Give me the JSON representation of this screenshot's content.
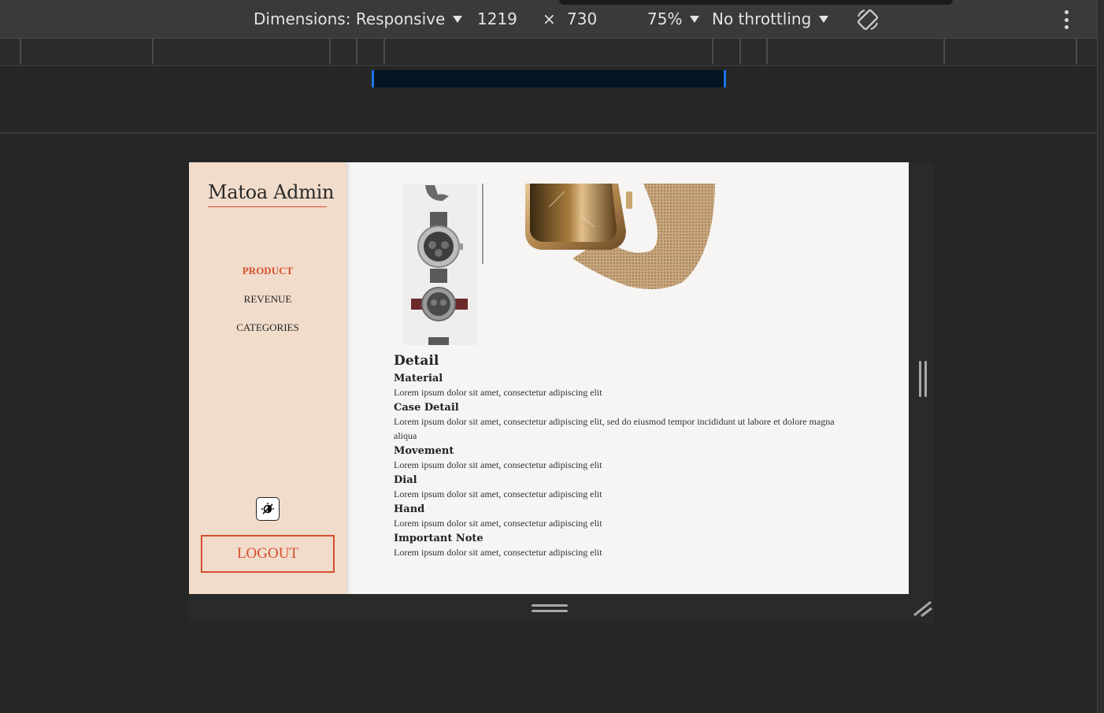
{
  "devtools": {
    "dimensions_label": "Dimensions: Responsive",
    "width": "1219",
    "times": "×",
    "height": "730",
    "zoom": "75%",
    "throttling": "No throttling",
    "icons": [
      "rotate-icon",
      "more-options-icon"
    ]
  },
  "app": {
    "brand": "Matoa Admin",
    "nav": [
      {
        "label": "PRODUCT",
        "active": true
      },
      {
        "label": "REVENUE",
        "active": false
      },
      {
        "label": "CATEGORIES",
        "active": false
      }
    ],
    "logout_label": "LOGOUT",
    "accent_color": "#d64e2f",
    "sidebar_color": "#f1dccb"
  },
  "detail": {
    "title": "Detail",
    "sections": [
      {
        "heading": "Material",
        "text": "Lorem ipsum dolor sit amet, consectetur adipiscing elit"
      },
      {
        "heading": "Case Detail",
        "text": "Lorem ipsum dolor sit amet, consectetur adipiscing elit, sed do eiusmod tempor incididunt ut labore et dolore magna aliqua"
      },
      {
        "heading": "Movement",
        "text": "Lorem ipsum dolor sit amet, consectetur adipiscing elit"
      },
      {
        "heading": "Dial",
        "text": "Lorem ipsum dolor sit amet, consectetur adipiscing elit"
      },
      {
        "heading": "Hand",
        "text": "Lorem ipsum dolor sit amet, consectetur adipiscing elit"
      },
      {
        "heading": "Important Note",
        "text": "Lorem ipsum dolor sit amet, consectetur adipiscing elit"
      }
    ]
  }
}
